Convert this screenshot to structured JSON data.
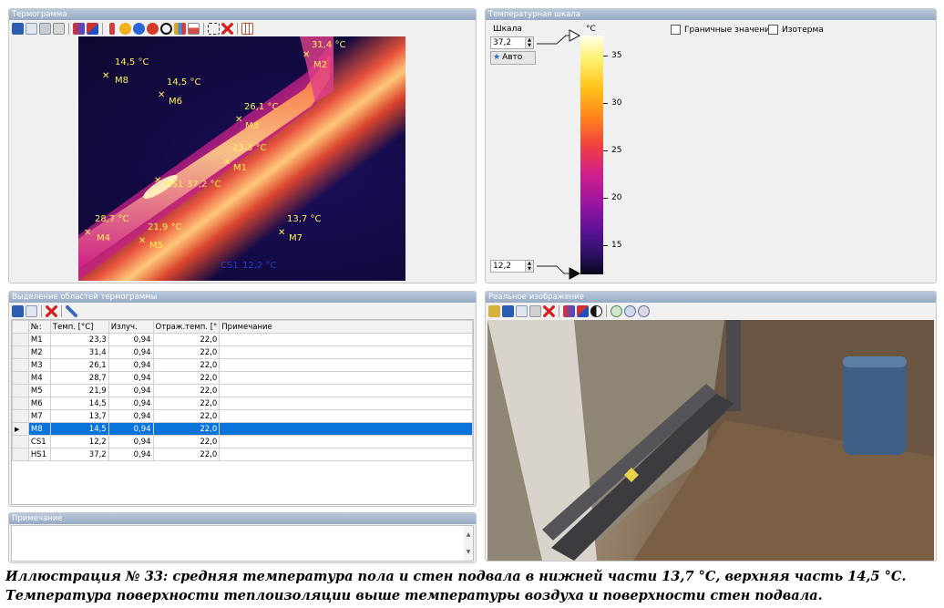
{
  "thermogram_panel": {
    "title": "Термограмма",
    "markers": [
      {
        "id": "M1",
        "temp": "23,3 °C"
      },
      {
        "id": "M2",
        "temp": "31,4 °C"
      },
      {
        "id": "M3",
        "temp": "26,1 °C"
      },
      {
        "id": "M4",
        "temp": "28,7 °C"
      },
      {
        "id": "M5",
        "temp": "21,9 °C"
      },
      {
        "id": "M6",
        "temp": "14,5 °C"
      },
      {
        "id": "M7",
        "temp": "13,7 °C"
      },
      {
        "id": "M8",
        "temp": "14,5 °C"
      },
      {
        "id": "HS1",
        "temp": "37,2 °C"
      },
      {
        "id": "CS1",
        "temp": "12,2 °C"
      }
    ]
  },
  "scale_panel": {
    "title": "Температурная шкала",
    "scale_label": "Шкала",
    "max_value": "37,2",
    "min_value": "12,2",
    "auto_button": "Авто",
    "unit": "°C",
    "ticks": [
      "35",
      "30",
      "25",
      "20",
      "15"
    ],
    "boundary_checkbox": "Граничные значения",
    "isotherm_checkbox": "Изотерма"
  },
  "regions_panel": {
    "title": "Выделение областей термограммы",
    "columns": [
      "№:",
      "Темп. [°C]",
      "Излуч.",
      "Отраж.темп. [°",
      "Примечание"
    ],
    "rows": [
      {
        "name": "M1",
        "temp": "23,3",
        "emis": "0,94",
        "refl": "22,0",
        "note": ""
      },
      {
        "name": "M2",
        "temp": "31,4",
        "emis": "0,94",
        "refl": "22,0",
        "note": ""
      },
      {
        "name": "M3",
        "temp": "26,1",
        "emis": "0,94",
        "refl": "22,0",
        "note": ""
      },
      {
        "name": "M4",
        "temp": "28,7",
        "emis": "0,94",
        "refl": "22,0",
        "note": ""
      },
      {
        "name": "M5",
        "temp": "21,9",
        "emis": "0,94",
        "refl": "22,0",
        "note": ""
      },
      {
        "name": "M6",
        "temp": "14,5",
        "emis": "0,94",
        "refl": "22,0",
        "note": ""
      },
      {
        "name": "M7",
        "temp": "13,7",
        "emis": "0,94",
        "refl": "22,0",
        "note": ""
      },
      {
        "name": "M8",
        "temp": "14,5",
        "emis": "0,94",
        "refl": "22,0",
        "note": ""
      },
      {
        "name": "CS1",
        "temp": "12,2",
        "emis": "0,94",
        "refl": "22,0",
        "note": ""
      },
      {
        "name": "HS1",
        "temp": "37,2",
        "emis": "0,94",
        "refl": "22,0",
        "note": ""
      }
    ],
    "selected_row": "M8"
  },
  "note_panel": {
    "title": "Примечание",
    "value": ""
  },
  "photo_panel": {
    "title": "Реальное изображение"
  },
  "caption": {
    "line1": "Иллюстрация № 33: средняя температура пола и стен подвала в нижней части 13,7 °С, верхняя часть 14,5 °С.",
    "line2": "Температура поверхности теплоизоляции выше температуры воздуха и поверхности стен подвала."
  },
  "colors": {
    "panel_title": "#a6b8ce",
    "selection": "#0a74da",
    "marker": "#fff15a"
  }
}
